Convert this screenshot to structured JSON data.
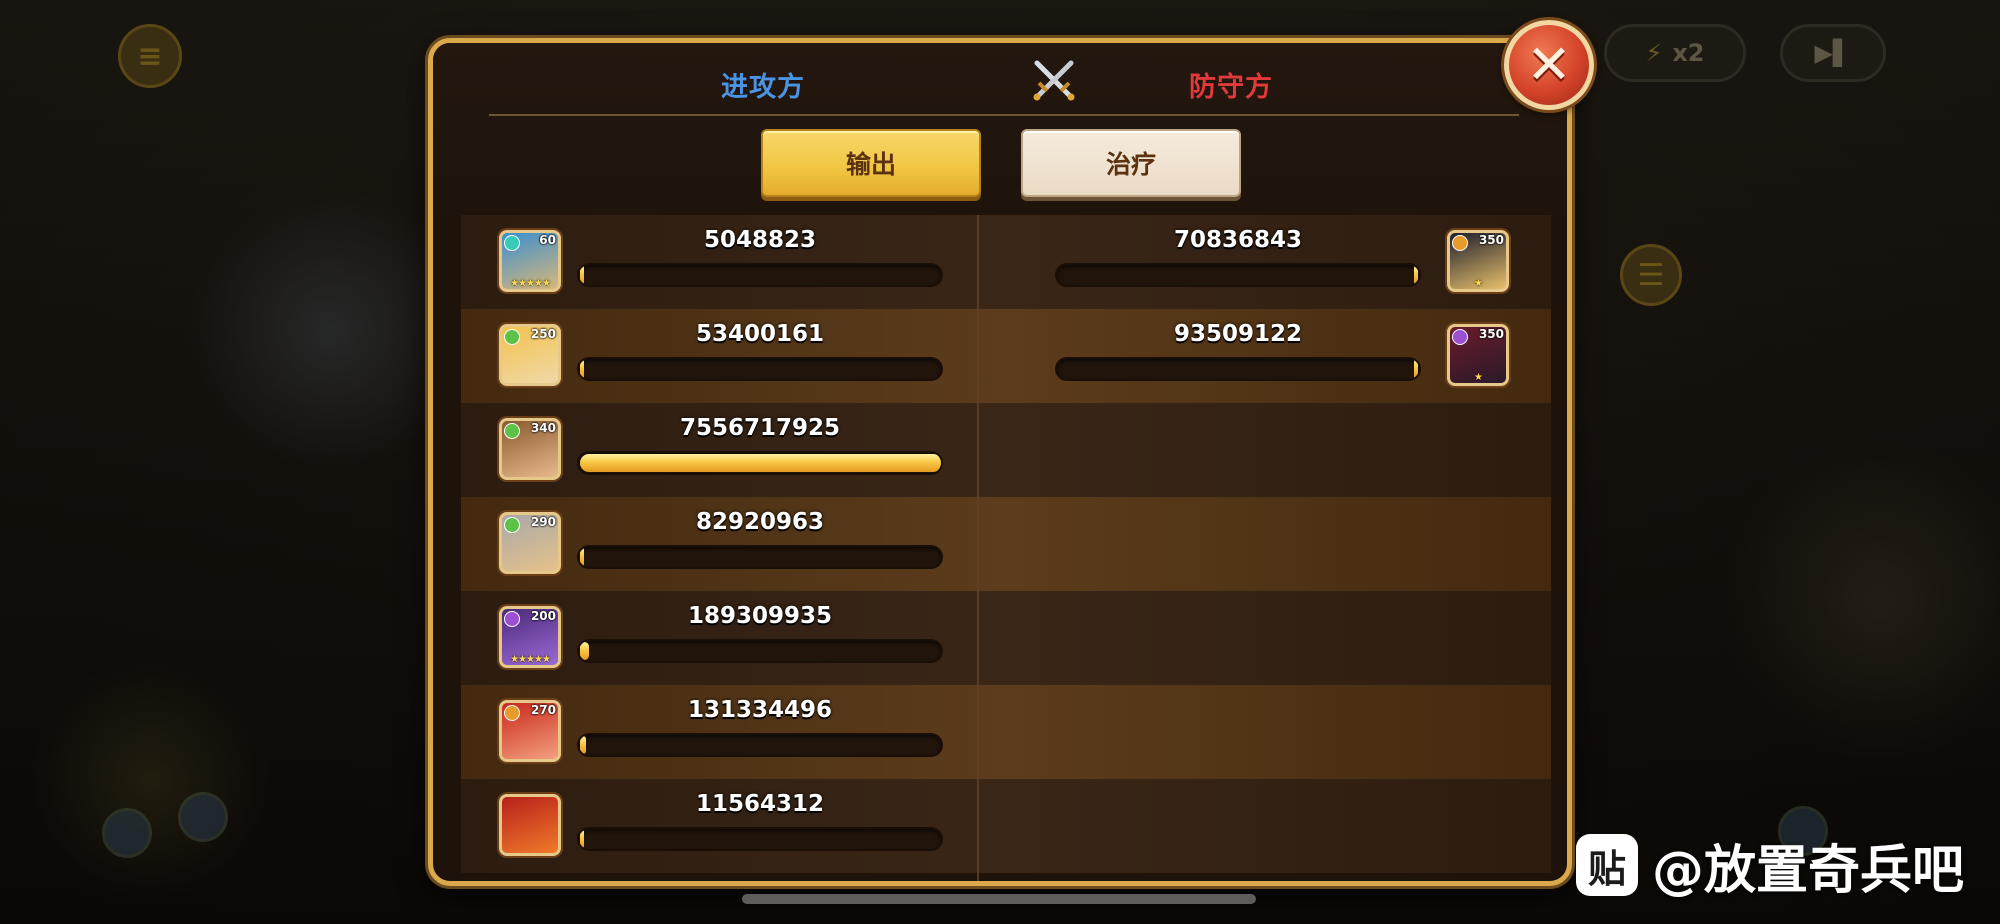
{
  "sides": {
    "attack_label": "进攻方",
    "defense_label": "防守方"
  },
  "tabs": [
    {
      "label": "输出",
      "selected": true
    },
    {
      "label": "治疗",
      "selected": false
    }
  ],
  "close_icon": "close-x",
  "attackers": [
    {
      "value": "5048823",
      "level": "60",
      "faction_color": "#38c9b8",
      "portrait": [
        "#3a8fd0",
        "#d8b77a"
      ],
      "stars": "★★★★★",
      "fill": 0.01
    },
    {
      "value": "53400161",
      "level": "250",
      "faction_color": "#5cc24a",
      "portrait": [
        "#f3c24d",
        "#f0d9a8"
      ],
      "stars": "",
      "fill": 0.007
    },
    {
      "value": "7556717925",
      "level": "340",
      "faction_color": "#5cc24a",
      "portrait": [
        "#8a5a2f",
        "#e8b98d"
      ],
      "stars": "",
      "fill": 1.0
    },
    {
      "value": "82920963",
      "level": "290",
      "faction_color": "#5cc24a",
      "portrait": [
        "#a9a9a9",
        "#e6c18a"
      ],
      "stars": "",
      "fill": 0.011
    },
    {
      "value": "189309935",
      "level": "200",
      "faction_color": "#9b4fd1",
      "portrait": [
        "#4b2a78",
        "#9b6ad6"
      ],
      "stars": "★★★★★",
      "fill": 0.025
    },
    {
      "value": "131334496",
      "level": "270",
      "faction_color": "#e89a2a",
      "portrait": [
        "#c8281c",
        "#f4a080"
      ],
      "stars": "",
      "fill": 0.017
    },
    {
      "value": "11564312",
      "level": "",
      "faction_color": "",
      "portrait": [
        "#b8201a",
        "#f07a2a"
      ],
      "stars": "",
      "fill": 0.002
    }
  ],
  "defenders": [
    {
      "value": "70836843",
      "level": "350",
      "faction_color": "#e89a2a",
      "portrait": [
        "#1e1e2e",
        "#e8c06a"
      ],
      "stars": "★",
      "fill": 0.009
    },
    {
      "value": "93509122",
      "level": "350",
      "faction_color": "#9b4fd1",
      "portrait": [
        "#6a1b2a",
        "#2a1a2a"
      ],
      "stars": "★",
      "fill": 0.012
    }
  ],
  "watermark": {
    "logo": "贴",
    "text": "@放置奇兵吧"
  },
  "background": {
    "speed_label": "x2"
  }
}
